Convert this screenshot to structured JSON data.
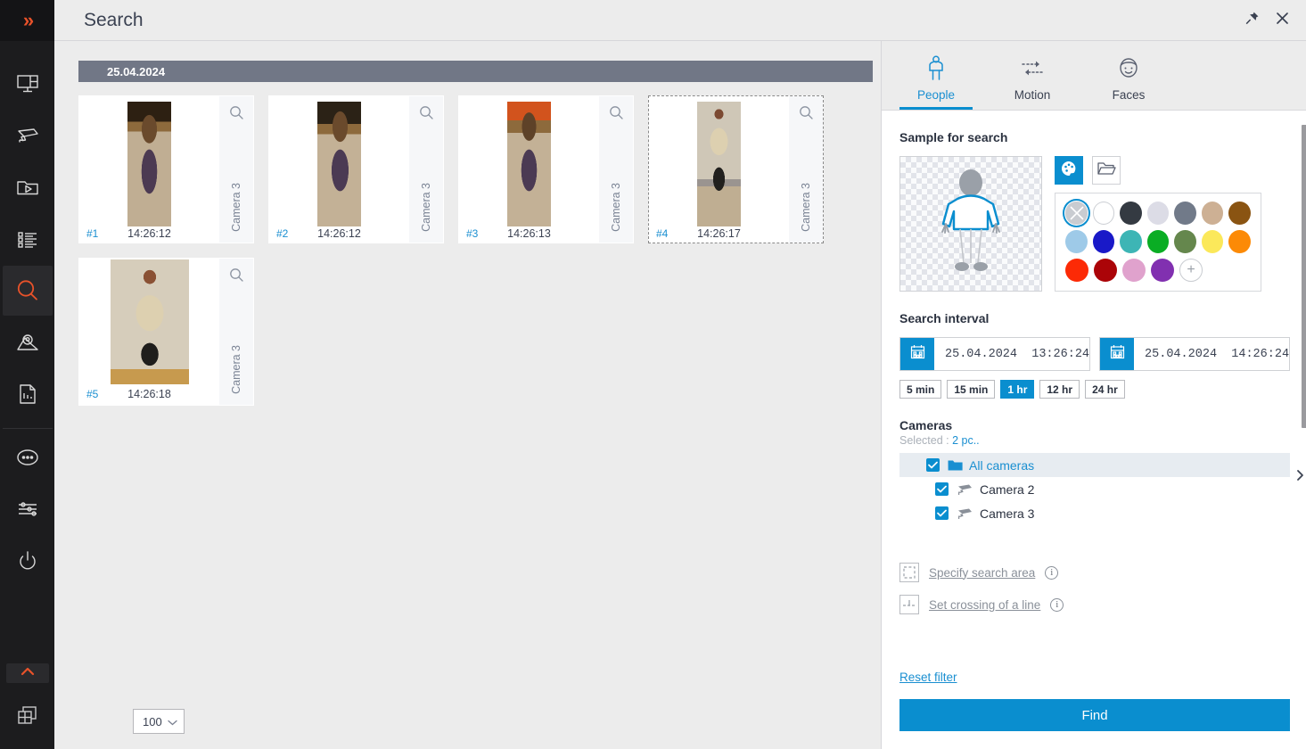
{
  "window": {
    "title": "Search",
    "pin_icon": "pin-icon",
    "close_icon": "close-icon"
  },
  "rail": {
    "expand_icon": "double-chevron-right-icon",
    "items": [
      {
        "name": "layouts-icon",
        "label": "Layouts"
      },
      {
        "name": "cameras-icon",
        "label": "Cameras"
      },
      {
        "name": "archive-icon",
        "label": "Archive"
      },
      {
        "name": "events-list-icon",
        "label": "Events"
      },
      {
        "name": "search-icon",
        "label": "Search",
        "active": true
      },
      {
        "name": "map-icon",
        "label": "Map"
      },
      {
        "name": "reports-icon",
        "label": "Reports"
      },
      {
        "name": "more-icon",
        "label": "More"
      },
      {
        "name": "settings-sliders-icon",
        "label": "Settings"
      },
      {
        "name": "power-icon",
        "label": "Power"
      }
    ],
    "collapse_icon": "chevron-up-icon",
    "bottom_icon": "windows-tile-icon"
  },
  "results": {
    "date_group": "25.04.2024",
    "cards": [
      {
        "index": "#1",
        "time": "14:26:12",
        "camera": "Camera 3",
        "selected": false,
        "zoom_icon": "magnifier-icon"
      },
      {
        "index": "#2",
        "time": "14:26:12",
        "camera": "Camera 3",
        "selected": false,
        "zoom_icon": "magnifier-icon"
      },
      {
        "index": "#3",
        "time": "14:26:13",
        "camera": "Camera 3",
        "selected": false,
        "zoom_icon": "magnifier-icon"
      },
      {
        "index": "#4",
        "time": "14:26:17",
        "camera": "Camera 3",
        "selected": true,
        "zoom_icon": "magnifier-icon"
      },
      {
        "index": "#5",
        "time": "14:26:18",
        "camera": "Camera 3",
        "selected": false,
        "zoom_icon": "magnifier-icon"
      }
    ],
    "page_size": "100",
    "page_size_caret": "chevron-down-icon"
  },
  "panel": {
    "tabs": [
      {
        "label": "People",
        "icon": "person-icon",
        "active": true
      },
      {
        "label": "Motion",
        "icon": "motion-arrows-icon",
        "active": false
      },
      {
        "label": "Faces",
        "icon": "face-icon",
        "active": false
      }
    ],
    "sample": {
      "title": "Sample for search",
      "figure_icon": "person-silhouette-icon",
      "palette_btn_icon": "palette-icon",
      "folder_btn_icon": "folder-open-icon",
      "add_color_icon": "plus-icon",
      "colors": [
        {
          "name": "any",
          "hex": "#c9ccd1",
          "selected": true,
          "cross": true
        },
        {
          "name": "white",
          "hex": "#ffffff",
          "outlined": true
        },
        {
          "name": "black",
          "hex": "#343a42"
        },
        {
          "name": "light-gray",
          "hex": "#dcdce6"
        },
        {
          "name": "gray",
          "hex": "#717a89"
        },
        {
          "name": "beige",
          "hex": "#cdb094"
        },
        {
          "name": "brown",
          "hex": "#8a5412"
        },
        {
          "name": "light-blue",
          "hex": "#9ecae8"
        },
        {
          "name": "blue",
          "hex": "#1919c8"
        },
        {
          "name": "teal",
          "hex": "#3db5b5"
        },
        {
          "name": "green",
          "hex": "#0aad24"
        },
        {
          "name": "olive",
          "hex": "#65874d"
        },
        {
          "name": "yellow",
          "hex": "#fbe85a"
        },
        {
          "name": "orange",
          "hex": "#fc8a06"
        },
        {
          "name": "red",
          "hex": "#fc2a06"
        },
        {
          "name": "dark-red",
          "hex": "#ab0408"
        },
        {
          "name": "pink",
          "hex": "#e0a2cd"
        },
        {
          "name": "purple",
          "hex": "#8130b0"
        }
      ]
    },
    "interval": {
      "title": "Search interval",
      "from_date": "25.04.2024",
      "from_time": "13:26:24",
      "to_date": "25.04.2024",
      "to_time": "14:26:24",
      "calendar_icon": "calendar-icon",
      "presets": [
        {
          "label": "5 min",
          "active": false
        },
        {
          "label": "15 min",
          "active": false
        },
        {
          "label": "1 hr",
          "active": true
        },
        {
          "label": "12 hr",
          "active": false
        },
        {
          "label": "24 hr",
          "active": false
        }
      ]
    },
    "cameras": {
      "title": "Cameras",
      "selected_prefix": "Selected :",
      "selected_count": "2 pc..",
      "folder_icon": "folder-icon",
      "tree": [
        {
          "label": "All cameras",
          "checked": true,
          "root": true,
          "icon": "folder-icon"
        },
        {
          "label": "Camera 2",
          "checked": true,
          "root": false,
          "icon": "camera-icon"
        },
        {
          "label": "Camera 3",
          "checked": true,
          "root": false,
          "icon": "camera-icon"
        }
      ]
    },
    "extras": [
      {
        "label": "Specify search area",
        "icon": "dashed-rect-icon",
        "info_icon": "info-icon"
      },
      {
        "label": "Set crossing of a line",
        "icon": "crossing-line-icon",
        "info_icon": "info-icon"
      }
    ],
    "reset_label": "Reset filter",
    "find_label": "Find",
    "collapse_icon": "chevron-right-icon"
  },
  "colors": {
    "accent": "#0a8ecf",
    "link": "#1a8fd1",
    "rail_bg": "#1c1c1e",
    "rail_active": "#e8522a",
    "chrome_bg": "#ececec",
    "date_bar": "#717786"
  }
}
